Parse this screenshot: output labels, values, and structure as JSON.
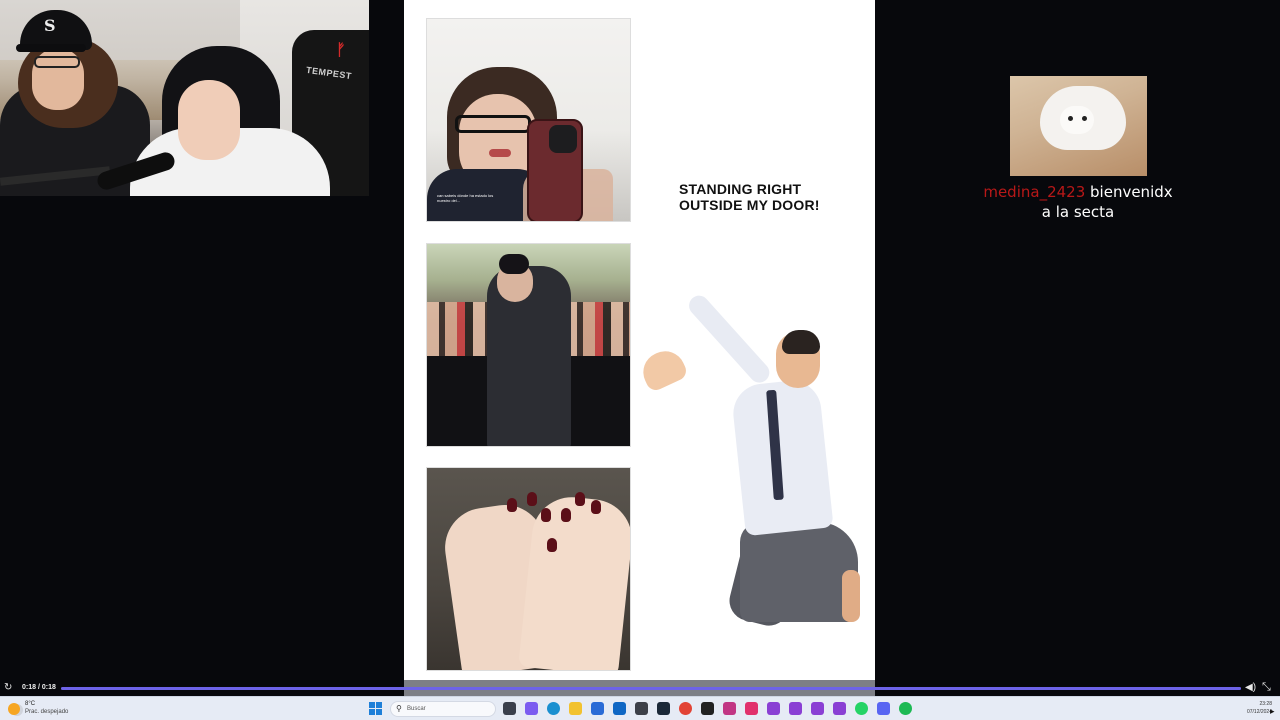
{
  "stream": {
    "chair_brand": "TEMPEST",
    "cap_logo": "S"
  },
  "meme": {
    "caption_line1": "STANDING RIGHT",
    "caption_line2": "OUTSIDE MY DOOR!",
    "photo1_subtitle": "can sabeis dónde ha estado los nuestro del..."
  },
  "chat": {
    "username": "medina_2423",
    "message": "bienvenidx a la secta",
    "username_color": "#b81818"
  },
  "player": {
    "time": "0:18 / 0:18",
    "progress": 1.0,
    "accent": "#6d63e8"
  },
  "taskbar": {
    "temperature": "8°C",
    "weather": "Prac. despejado",
    "search_placeholder": "Buscar",
    "clock_time": "23:28",
    "clock_date": "07/12/2024",
    "apps": [
      {
        "name": "task-view-icon",
        "color": "#3a3f4c"
      },
      {
        "name": "copilot-icon",
        "color": "#7b5cf0"
      },
      {
        "name": "edge-icon",
        "color": "#1a8fd0"
      },
      {
        "name": "file-explorer-icon",
        "color": "#f2c230"
      },
      {
        "name": "store-icon",
        "color": "#2a6bd6"
      },
      {
        "name": "outlook-icon",
        "color": "#1067c4"
      },
      {
        "name": "app-icon",
        "color": "#3c3f48"
      },
      {
        "name": "steam-icon",
        "color": "#1b2838"
      },
      {
        "name": "chrome-icon",
        "color": "#e24335"
      },
      {
        "name": "capcut-icon",
        "color": "#222222"
      },
      {
        "name": "instagram-icon",
        "color": "#c13584"
      },
      {
        "name": "app-icon",
        "color": "#e1306c"
      },
      {
        "name": "app-icon",
        "color": "#8a3fd4"
      },
      {
        "name": "app-icon",
        "color": "#8a3fd4"
      },
      {
        "name": "app-icon",
        "color": "#8a3fd4"
      },
      {
        "name": "app-icon",
        "color": "#8a3fd4"
      },
      {
        "name": "whatsapp-icon",
        "color": "#25d366"
      },
      {
        "name": "discord-icon",
        "color": "#5865f2"
      },
      {
        "name": "spotify-icon",
        "color": "#1db954"
      }
    ]
  }
}
